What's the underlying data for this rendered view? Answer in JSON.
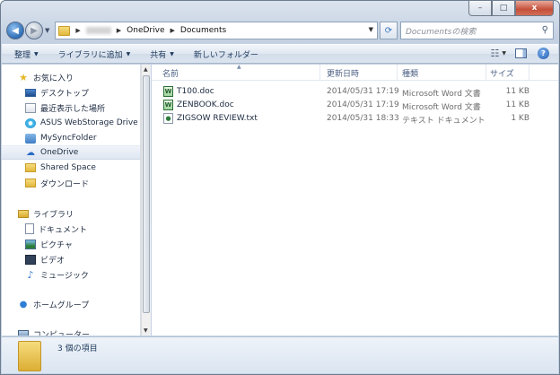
{
  "window": {
    "caption_buttons": {
      "minimize": "–",
      "maximize": "□",
      "close": "x"
    }
  },
  "address": {
    "crumbs": [
      "OneDrive",
      "Documents"
    ],
    "search_placeholder": "Documentsの検索"
  },
  "toolbar": {
    "organize": "整理",
    "add_to_library": "ライブラリに追加",
    "share": "共有",
    "new_folder": "新しいフォルダー"
  },
  "sidebar": {
    "favorites": "お気に入り",
    "favorite_items": [
      "デスクトップ",
      "最近表示した場所",
      "ASUS WebStorage Drive",
      "MySyncFolder",
      "OneDrive",
      "Shared Space",
      "ダウンロード"
    ],
    "libraries": "ライブラリ",
    "library_items": [
      "ドキュメント",
      "ピクチャ",
      "ビデオ",
      "ミュージック"
    ],
    "homegroup": "ホームグループ",
    "computer": "コンピューター"
  },
  "columns": {
    "name": "名前",
    "date": "更新日時",
    "type": "種類",
    "size": "サイズ"
  },
  "files": [
    {
      "name": "T100.doc",
      "date": "2014/05/31 17:19",
      "type": "Microsoft Word 文書",
      "size": "11 KB"
    },
    {
      "name": "ZENBOOK.doc",
      "date": "2014/05/31 17:19",
      "type": "Microsoft Word 文書",
      "size": "11 KB"
    },
    {
      "name": "ZIGSOW REVIEW.txt",
      "date": "2014/05/31 18:33",
      "type": "テキスト ドキュメント",
      "size": "1 KB"
    }
  ],
  "status": {
    "item_count": "3 個の項目"
  }
}
